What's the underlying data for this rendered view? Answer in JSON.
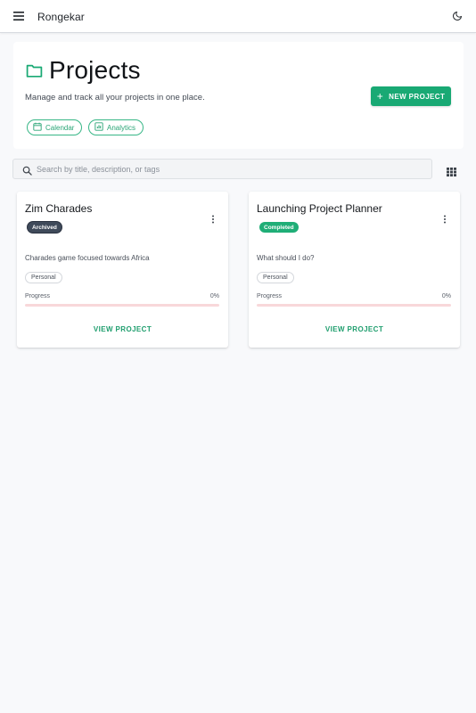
{
  "app": {
    "name": "Rongekar"
  },
  "header": {
    "title": "Projects",
    "subtitle": "Manage and track all your projects in one place.",
    "new_project_label": "NEW PROJECT",
    "chips": [
      {
        "label": "Calendar",
        "icon": "calendar-icon"
      },
      {
        "label": "Analytics",
        "icon": "chart-icon"
      }
    ]
  },
  "search": {
    "placeholder": "Search by title, description, or tags",
    "value": ""
  },
  "projects": [
    {
      "title": "Zim Charades",
      "status": "Archived",
      "description": "Charades game focused towards Africa",
      "tag": "Personal",
      "progress_label": "Progress",
      "progress": "0%",
      "action": "VIEW PROJECT"
    },
    {
      "title": "Launching Project Planner",
      "status": "Completed",
      "description": "What should I do?",
      "tag": "Personal",
      "progress_label": "Progress",
      "progress": "0%",
      "action": "VIEW PROJECT"
    }
  ],
  "colors": {
    "accent": "#19a974",
    "archived": "#3f4a5a",
    "completed": "#1fae77",
    "progress_track": "#f8d8da"
  }
}
